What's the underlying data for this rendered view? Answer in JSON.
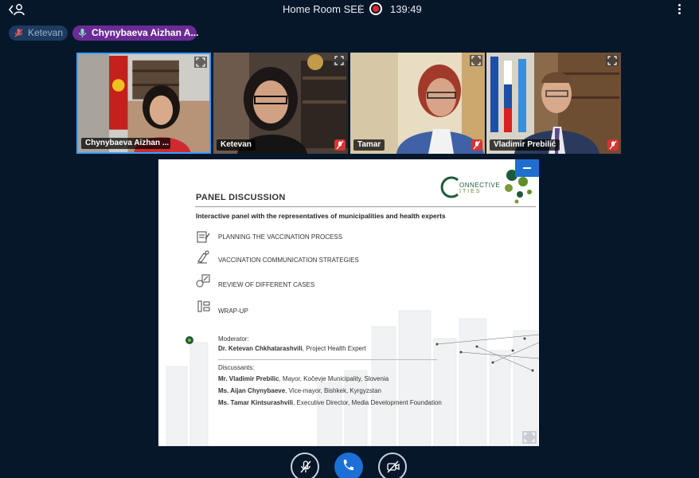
{
  "header": {
    "room_name": "Home Room SEE",
    "timer": "139:49"
  },
  "talkers": [
    {
      "name": "Ketevan",
      "muted": true
    },
    {
      "name": "Chynybaeva Aizhan A...",
      "muted": false
    }
  ],
  "participants": [
    {
      "name": "Chynybaeva Aizhan ...",
      "muted": false,
      "active": true
    },
    {
      "name": "Ketevan",
      "muted": true
    },
    {
      "name": "Tamar",
      "muted": true
    },
    {
      "name": "Vladimir Prebilić",
      "muted": true
    }
  ],
  "slide": {
    "logo_line1": "ONNECTIVE",
    "logo_line2": "ITIES",
    "title": "PANEL DISCUSSION",
    "subtitle": "Interactive panel with the representatives of municipalities and health experts",
    "agenda": [
      {
        "label": "PLANNING THE VACCINATION PROCESS",
        "icon": "clipboard-icon"
      },
      {
        "label": "VACCINATION COMMUNICATION STRATEGIES",
        "icon": "microscope-icon"
      },
      {
        "label": "REVIEW OF DIFFERENT CASES",
        "icon": "cases-icon"
      },
      {
        "label": "WRAP-UP",
        "icon": "vaccine-icon"
      }
    ],
    "moderator_label": "Moderator:",
    "moderator_name": "Dr. Ketevan Chkhatarashvili",
    "moderator_role": ", Project Health Expert",
    "discussants_label": "Discussants:",
    "discussants": [
      {
        "name": "Mr. Vladimir Prebilic",
        "role": ", Mayor, Kočevje Municipality, Slovenia"
      },
      {
        "name": "Ms. Aijan Chynybaeve",
        "role": ", Vice-mayor, Bishkek, Kyrgyzstan"
      },
      {
        "name": "Ms. Tamar Kintsurashvili",
        "role": ", Executive Director, Media Development Foundation"
      }
    ]
  },
  "colors": {
    "background": "#06172a",
    "accent": "#1b6fd6",
    "active_speaker": "#6b2b95",
    "record": "#e02a2a"
  }
}
